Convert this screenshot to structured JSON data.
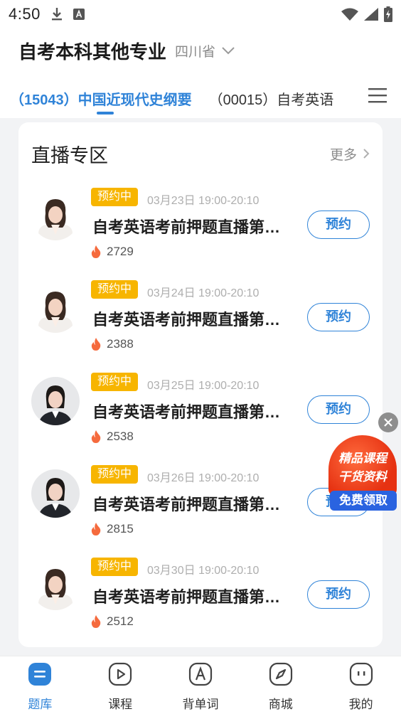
{
  "status_bar": {
    "time": "4:50",
    "icons": [
      "download-icon",
      "a-box-icon",
      "wifi-icon",
      "signal-icon",
      "battery-charging-icon"
    ]
  },
  "header": {
    "title": "自考本科其他专业",
    "province": "四川省"
  },
  "tabs": [
    {
      "label": "（15043）中国近现代史纲要",
      "active": true
    },
    {
      "label": "（00015）自考英语",
      "active": false
    }
  ],
  "live_section": {
    "title": "直播专区",
    "more_label": "更多",
    "items": [
      {
        "badge": "预约中",
        "time": "03月23日 19:00-20:10",
        "title": "自考英语考前押题直播第一期",
        "views": "2729",
        "button": "预约"
      },
      {
        "badge": "预约中",
        "time": "03月24日 19:00-20:10",
        "title": "自考英语考前押题直播第二期",
        "views": "2388",
        "button": "预约"
      },
      {
        "badge": "预约中",
        "time": "03月25日 19:00-20:10",
        "title": "自考英语考前押题直播第三期",
        "views": "2538",
        "button": "预约"
      },
      {
        "badge": "预约中",
        "time": "03月26日 19:00-20:10",
        "title": "自考英语考前押题直播第四期",
        "views": "2815",
        "button": "预约"
      },
      {
        "badge": "预约中",
        "time": "03月30日 19:00-20:10",
        "title": "自考英语考前押题直播第五期",
        "views": "2512",
        "button": "预约"
      }
    ]
  },
  "promo": {
    "line1": "精品课程",
    "line2": "干货资料",
    "button": "免费领取"
  },
  "bottom_nav": [
    {
      "label": "题库",
      "icon": "question-bank-icon",
      "active": true
    },
    {
      "label": "课程",
      "icon": "play-course-icon",
      "active": false
    },
    {
      "label": "背单词",
      "icon": "vocabulary-icon",
      "active": false
    },
    {
      "label": "商城",
      "icon": "compass-mall-icon",
      "active": false
    },
    {
      "label": "我的",
      "icon": "profile-icon",
      "active": false
    }
  ],
  "colors": {
    "accent": "#2f83d8",
    "badge": "#f7b500",
    "fire": "#f56a3d",
    "background": "#f2f3f5"
  }
}
